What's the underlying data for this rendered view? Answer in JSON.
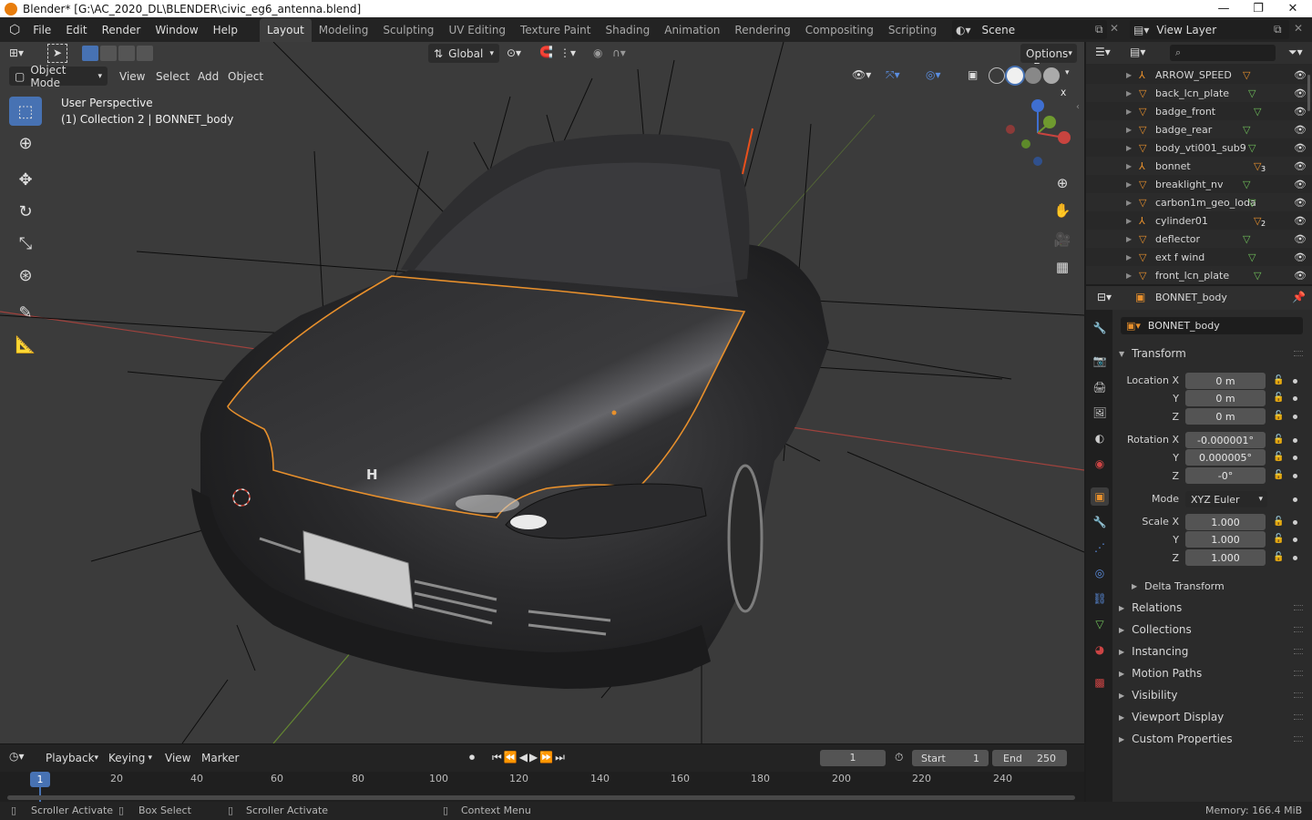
{
  "titlebar": {
    "title": "Blender* [G:\\AC_2020_DL\\BLENDER\\civic_eg6_antenna.blend]",
    "minimize": "—",
    "restore": "❐",
    "close": "✕"
  },
  "menu": [
    "File",
    "Edit",
    "Render",
    "Window",
    "Help"
  ],
  "workspaces": [
    "Layout",
    "Modeling",
    "Sculpting",
    "UV Editing",
    "Texture Paint",
    "Shading",
    "Animation",
    "Rendering",
    "Compositing",
    "Scripting"
  ],
  "active_workspace": "Layout",
  "add_workspace": "+",
  "scene": {
    "label": "Scene"
  },
  "view_layer": {
    "label": "View Layer"
  },
  "viewport": {
    "mode": "Object Mode",
    "menus": [
      "View",
      "Select",
      "Add",
      "Object"
    ],
    "orientation": "Global",
    "options_label": "Options",
    "overlay_title": "User Perspective",
    "overlay_collection": "(1) Collection 2 | BONNET_body",
    "brand_badge": "H",
    "gizmo": {
      "z": "Z",
      "y": "Y",
      "x": "X"
    },
    "colors": {
      "background": "#3b3b3b",
      "grid_red": "#c8443f",
      "grid_green": "#6f9a2f",
      "selection": "#e8902c"
    }
  },
  "tools": [
    "select-box",
    "cursor",
    "move",
    "rotate",
    "scale",
    "transform",
    "annotate",
    "measure"
  ],
  "outliner": {
    "search_placeholder": "",
    "items": [
      {
        "name": "ARROW_SPEED",
        "type": "empty",
        "badge": ""
      },
      {
        "name": "back_lcn_plate",
        "type": "mesh",
        "badge": ""
      },
      {
        "name": "badge_front",
        "type": "mesh",
        "badge": ""
      },
      {
        "name": "badge_rear",
        "type": "mesh",
        "badge": ""
      },
      {
        "name": "body_vti001_sub9",
        "type": "mesh",
        "badge": ""
      },
      {
        "name": "bonnet",
        "type": "empty",
        "badge": "3"
      },
      {
        "name": "breaklight_nv",
        "type": "mesh",
        "badge": ""
      },
      {
        "name": "carbon1m_geo_loda",
        "type": "mesh",
        "badge": ""
      },
      {
        "name": "cylinder01",
        "type": "empty",
        "badge": "2"
      },
      {
        "name": "deflector",
        "type": "mesh",
        "badge": ""
      },
      {
        "name": "ext f wind",
        "type": "mesh",
        "badge": ""
      },
      {
        "name": "front_lcn_plate",
        "type": "mesh",
        "badge": ""
      }
    ]
  },
  "properties": {
    "object_name": "BONNET_body",
    "data_name": "BONNET_body",
    "transform": {
      "title": "Transform",
      "location_label": "Location X",
      "rotation_label": "Rotation X",
      "scale_label": "Scale X",
      "axis_y": "Y",
      "axis_z": "Z",
      "location": [
        "0 m",
        "0 m",
        "0 m"
      ],
      "rotation": [
        "-0.000001°",
        "0.000005°",
        "-0°"
      ],
      "mode_label": "Mode",
      "mode": "XYZ Euler",
      "scale": [
        "1.000",
        "1.000",
        "1.000"
      ],
      "delta": "Delta Transform"
    },
    "panels": [
      "Relations",
      "Collections",
      "Instancing",
      "Motion Paths",
      "Visibility",
      "Viewport Display",
      "Custom Properties"
    ]
  },
  "timeline": {
    "menus": [
      "Playback",
      "Keying",
      "View",
      "Marker"
    ],
    "current_frame": "1",
    "start_label": "Start",
    "start": "1",
    "end_label": "End",
    "end": "250",
    "ticks": [
      "20",
      "40",
      "60",
      "80",
      "100",
      "120",
      "140",
      "160",
      "180",
      "200",
      "220",
      "240"
    ],
    "playhead": "1"
  },
  "statusbar": {
    "items": [
      "Scroller Activate",
      "Box Select",
      "Scroller Activate",
      "Context Menu"
    ],
    "memory": "Memory: 166.4 MiB"
  }
}
